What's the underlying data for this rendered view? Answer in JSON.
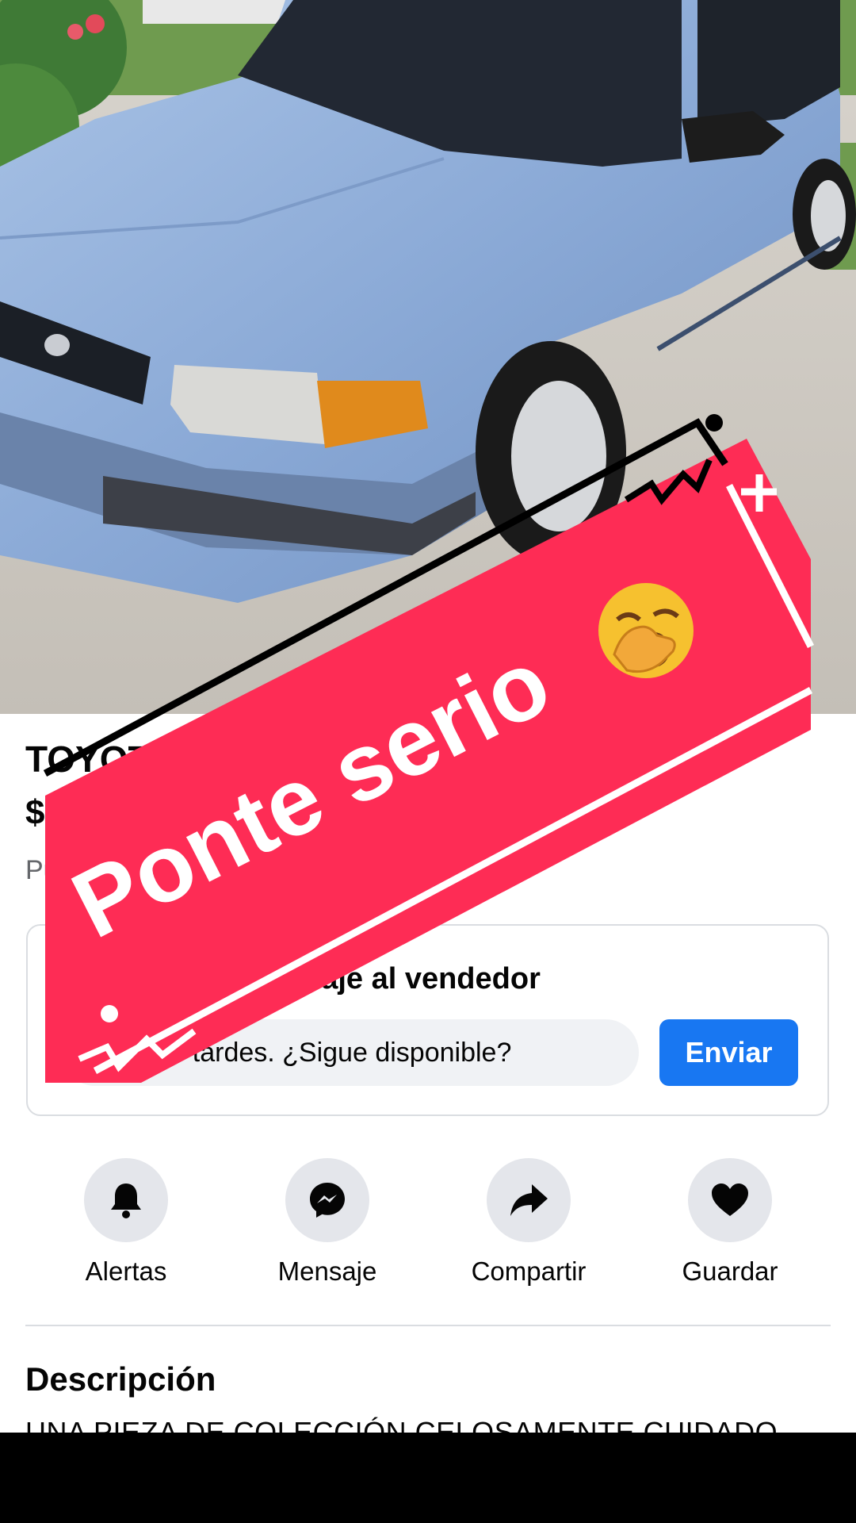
{
  "listing": {
    "title": "TOYOTA TERCEL 1997",
    "price": "$",
    "location": "Publicado hace 1 día en Mayagüez, PR"
  },
  "message_card": {
    "title": "Envía un mensaje al vendedor",
    "input_value": "Buenas tardes. ¿Sigue disponible?",
    "send_label": "Enviar",
    "icon": "messenger-icon"
  },
  "actions": [
    {
      "label": "Alertas",
      "icon": "bell-icon"
    },
    {
      "label": "Mensaje",
      "icon": "messenger-icon"
    },
    {
      "label": "Compartir",
      "icon": "share-arrow-icon"
    },
    {
      "label": "Guardar",
      "icon": "heart-icon"
    }
  ],
  "description": {
    "heading": "Descripción",
    "text": "UNA PIEZA DE COLECCIÓN CELOSAMENTE CUIDADO"
  },
  "overlay": {
    "text": "Ponte serio",
    "emoji_icon": "yawning-face-icon",
    "color": "#fe2c55"
  },
  "colors": {
    "accent": "#1877f2",
    "secondary_text": "#65676b",
    "action_circle": "#e4e6eb"
  }
}
